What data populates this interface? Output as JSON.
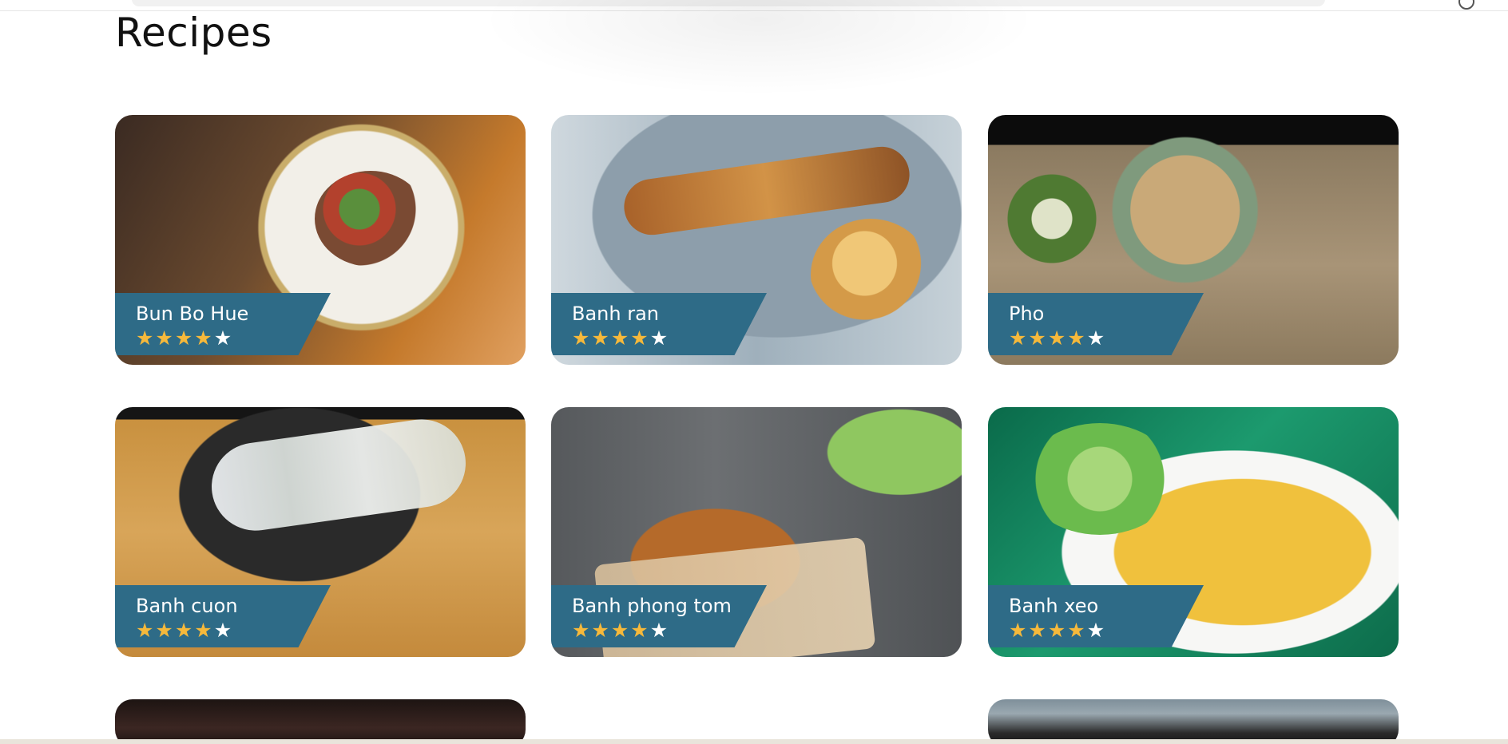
{
  "page": {
    "title": "Recipes"
  },
  "recipes": [
    {
      "name": "Bun Bo Hue",
      "rating": 4,
      "max_rating": 5
    },
    {
      "name": "Banh ran",
      "rating": 4,
      "max_rating": 5
    },
    {
      "name": "Pho",
      "rating": 4,
      "max_rating": 5
    },
    {
      "name": "Banh cuon",
      "rating": 4,
      "max_rating": 5
    },
    {
      "name": "Banh phong tom",
      "rating": 4,
      "max_rating": 5
    },
    {
      "name": "Banh xeo",
      "rating": 4,
      "max_rating": 5
    }
  ],
  "colors": {
    "label_bg": "#2e6b87",
    "star_filled": "#f6b93b",
    "star_empty": "#ffffff"
  },
  "icons": {
    "star": "star-icon",
    "user": "user-icon"
  },
  "star_glyph": "★"
}
